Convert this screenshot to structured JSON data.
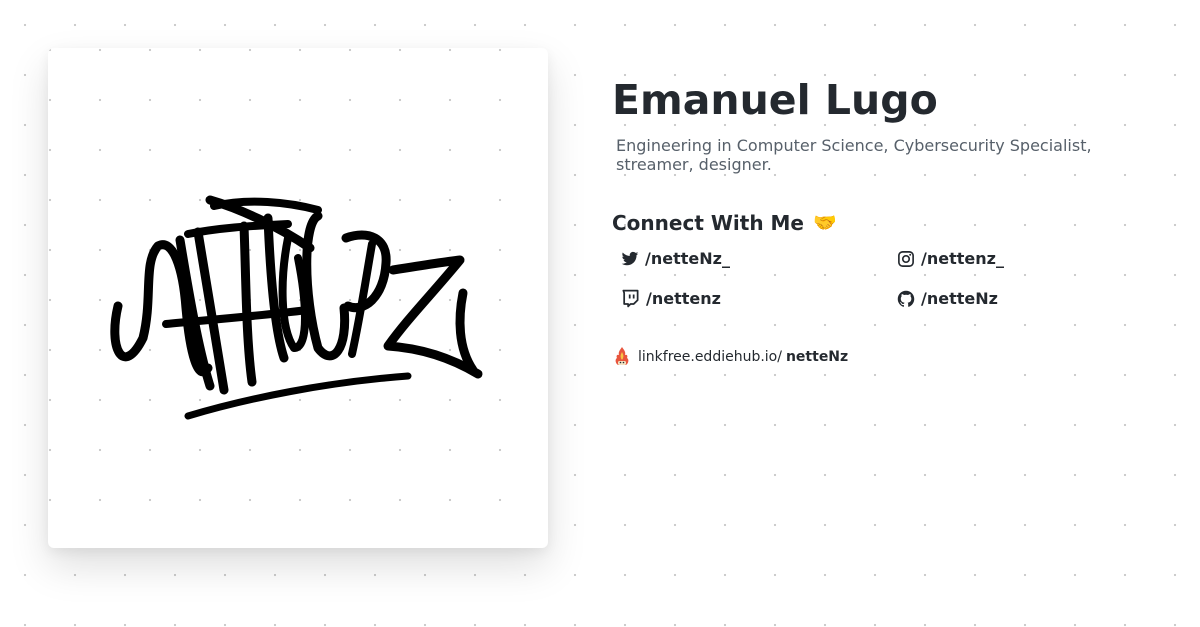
{
  "profile": {
    "name": "Emanuel Lugo",
    "bio": "Engineering in Computer Science, Cybersecurity Specialist, streamer, designer."
  },
  "connect": {
    "heading": "Connect With Me",
    "emoji": "🤝"
  },
  "socials": [
    {
      "icon": "twitter-icon",
      "handle": "/netteNz_"
    },
    {
      "icon": "instagram-icon",
      "handle": "/nettenz_"
    },
    {
      "icon": "twitch-icon",
      "handle": "/nettenz"
    },
    {
      "icon": "github-icon",
      "handle": "/netteNz"
    }
  ],
  "linkfree": {
    "icon": "eddiehub-logo-icon",
    "domain": "linkfree.eddiehub.io/",
    "username": "netteNz"
  },
  "avatar": {
    "icon": "graffiti-tag-logo"
  }
}
